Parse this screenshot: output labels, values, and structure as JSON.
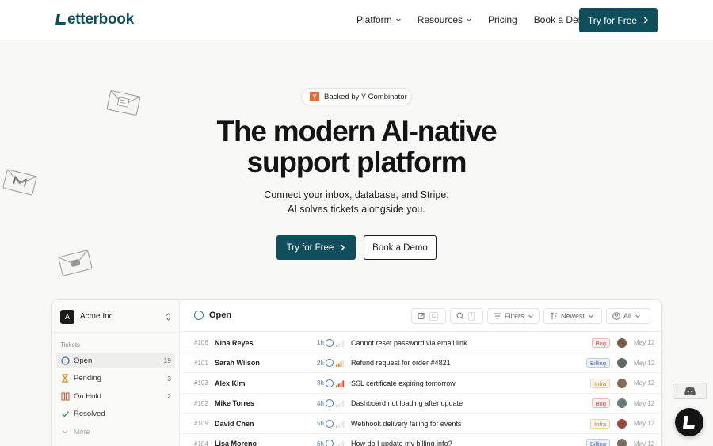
{
  "brand": {
    "logo_text": "etterbook",
    "accent": "#0f4f5c"
  },
  "nav": {
    "links": [
      {
        "label": "Platform",
        "dropdown": true
      },
      {
        "label": "Resources",
        "dropdown": true
      },
      {
        "label": "Pricing",
        "dropdown": false
      },
      {
        "label": "Book a Demo",
        "dropdown": false
      }
    ],
    "cta": "Try for Free"
  },
  "hero": {
    "badge_logo": "Y",
    "badge_text": "Backed by Y Combinator",
    "title_line1": "The modern AI-native",
    "title_line2": "support platform",
    "sub_line1": "Connect your inbox, database, and Stripe.",
    "sub_line2": "AI solves tickets alongside you.",
    "primary_cta": "Try for Free",
    "secondary_cta": "Book a Demo"
  },
  "app": {
    "workspace": {
      "avatar": "A",
      "name": "Acme Inc"
    },
    "sidebar_heading": "Tickets",
    "sidebar_items": [
      {
        "label": "Open",
        "count": "19",
        "icon": "open-circle-icon",
        "active": true
      },
      {
        "label": "Pending",
        "count": "3",
        "icon": "hourglass-icon",
        "active": false
      },
      {
        "label": "On Hold",
        "count": "2",
        "icon": "pause-icon",
        "active": false
      },
      {
        "label": "Resolved",
        "count": "",
        "icon": "check-icon",
        "active": false
      },
      {
        "label": "More",
        "count": "",
        "icon": "chevron-down-icon",
        "active": false
      }
    ],
    "header": {
      "title": "Open",
      "compose_kbd": "C",
      "search_kbd": "/",
      "filters_label": "Filters",
      "sort_label": "Newest",
      "assignee_label": "All"
    },
    "tickets": [
      {
        "id": "#106",
        "name": "Nina Reyes",
        "time": "1h",
        "priority": 1,
        "subject": "Cannot reset password via email link",
        "tag": "Bug",
        "date": "May 12"
      },
      {
        "id": "#101",
        "name": "Sarah Wilson",
        "time": "2h",
        "priority": 3,
        "subject": "Refund request for order #4821",
        "tag": "Billing",
        "date": "May 12"
      },
      {
        "id": "#103",
        "name": "Alex Kim",
        "time": "3h",
        "priority": 4,
        "subject": "SSL certificate expiring tomorrow",
        "tag": "Infra",
        "date": "May 12"
      },
      {
        "id": "#102",
        "name": "Mike Torres",
        "time": "4h",
        "priority": 1,
        "subject": "Dashboard not loading after update",
        "tag": "Bug",
        "date": "May 12"
      },
      {
        "id": "#109",
        "name": "David Chen",
        "time": "5h",
        "priority": 1,
        "subject": "Webhook delivery failing for events",
        "tag": "Infra",
        "date": "May 12"
      },
      {
        "id": "#104",
        "name": "Lisa Moreno",
        "time": "6h",
        "priority": 1,
        "subject": "How do I update my billing info?",
        "tag": "Billing",
        "date": "May 12"
      }
    ],
    "tag_colors": {
      "Bug": {
        "fg": "#d64545",
        "bg": "#fdeeee",
        "border": "#f2b8b8"
      },
      "Billing": {
        "fg": "#4a6fb0",
        "bg": "#eef2fb",
        "border": "#bfcdea"
      },
      "Infra": {
        "fg": "#c98a1a",
        "bg": "#fdf6e9",
        "border": "#efd39c"
      }
    },
    "avatar_colors": [
      "#7a5a48",
      "#5d6b66",
      "#8a6a58",
      "#6a7a7e",
      "#9a4a3a",
      "#7a6a5a"
    ]
  }
}
